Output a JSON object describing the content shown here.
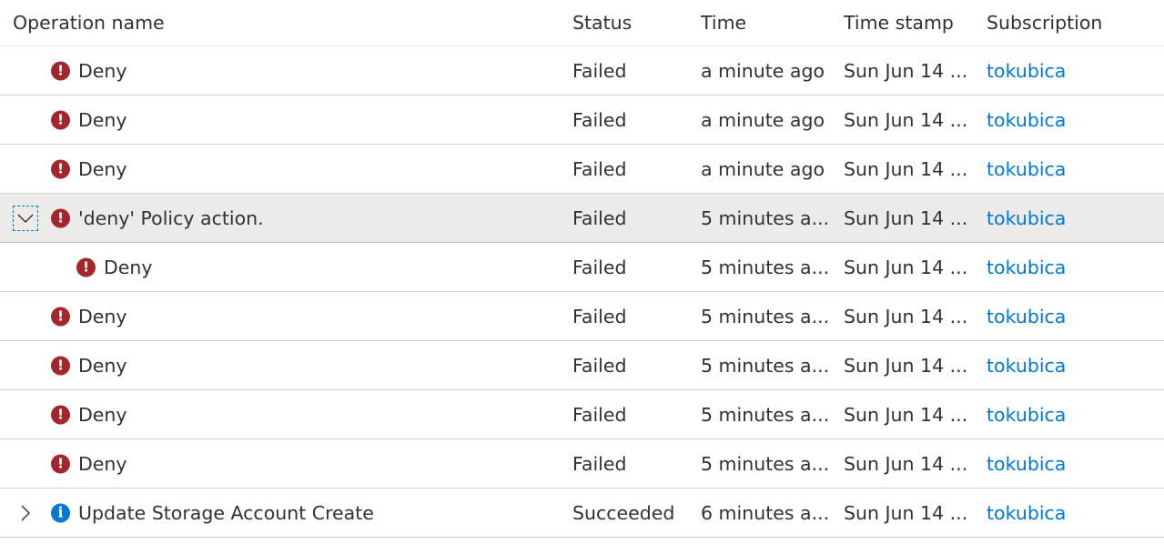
{
  "columns": {
    "operation_name": "Operation name",
    "status": "Status",
    "time": "Time",
    "time_stamp": "Time stamp",
    "subscription": "Subscription"
  },
  "colors": {
    "error": "#a4262c",
    "info": "#0078d4",
    "link": "#0078d4",
    "selected_row": "#edebe9"
  },
  "rows": [
    {
      "operation": "Deny",
      "icon": "error-icon",
      "status": "Failed",
      "time": "a minute ago",
      "time_stamp": "Sun Jun 14 ...",
      "subscription": "tokubica"
    },
    {
      "operation": "Deny",
      "icon": "error-icon",
      "status": "Failed",
      "time": "a minute ago",
      "time_stamp": "Sun Jun 14 ...",
      "subscription": "tokubica"
    },
    {
      "operation": "Deny",
      "icon": "error-icon",
      "status": "Failed",
      "time": "a minute ago",
      "time_stamp": "Sun Jun 14 ...",
      "subscription": "tokubica"
    },
    {
      "operation": "'deny' Policy action.",
      "icon": "error-icon",
      "status": "Failed",
      "time": "5 minutes a...",
      "time_stamp": "Sun Jun 14 ...",
      "subscription": "tokubica",
      "expander": "chevron-down-icon",
      "expanded": true,
      "selected": true
    },
    {
      "operation": "Deny",
      "icon": "error-icon",
      "status": "Failed",
      "time": "5 minutes a...",
      "time_stamp": "Sun Jun 14 ...",
      "subscription": "tokubica",
      "child": true
    },
    {
      "operation": "Deny",
      "icon": "error-icon",
      "status": "Failed",
      "time": "5 minutes a...",
      "time_stamp": "Sun Jun 14 ...",
      "subscription": "tokubica"
    },
    {
      "operation": "Deny",
      "icon": "error-icon",
      "status": "Failed",
      "time": "5 minutes a...",
      "time_stamp": "Sun Jun 14 ...",
      "subscription": "tokubica"
    },
    {
      "operation": "Deny",
      "icon": "error-icon",
      "status": "Failed",
      "time": "5 minutes a...",
      "time_stamp": "Sun Jun 14 ...",
      "subscription": "tokubica"
    },
    {
      "operation": "Deny",
      "icon": "error-icon",
      "status": "Failed",
      "time": "5 minutes a...",
      "time_stamp": "Sun Jun 14 ...",
      "subscription": "tokubica"
    },
    {
      "operation": "Update Storage Account Create",
      "icon": "info-icon",
      "status": "Succeeded",
      "time": "6 minutes a...",
      "time_stamp": "Sun Jun 14 ...",
      "subscription": "tokubica",
      "expander": "chevron-right-icon",
      "expanded": false
    }
  ]
}
